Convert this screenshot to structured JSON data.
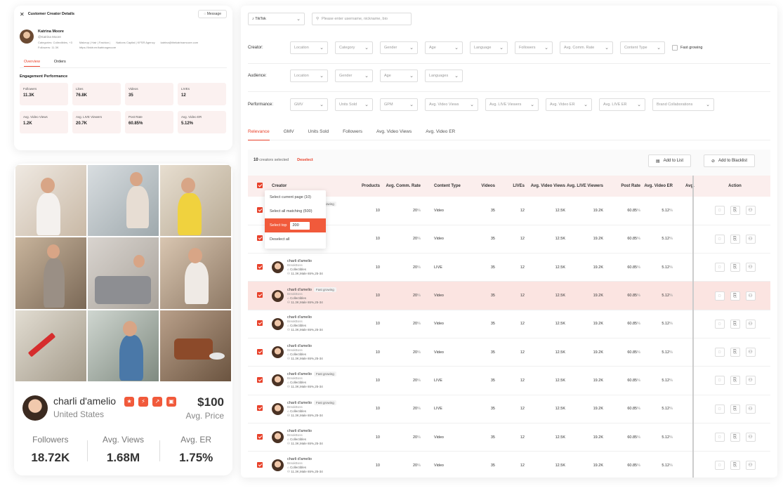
{
  "details": {
    "title": "Customer Creator Details",
    "message_label": "Message",
    "name": "Katrina Moore",
    "handle": "@Katrina Moore",
    "categories": "Categories: Collectibles, +3",
    "followers": "Followers: 11.3K",
    "tags": "Makeup | Hair | Fashion |",
    "agency": "Nations Capital | KFSR Agency",
    "email": "katrina@thekatrinamoore.com",
    "link": "https://linktr.ee/katrinagmoore",
    "tabs": [
      "Overview",
      "Orders"
    ],
    "engagement_title": "Engagement Performance",
    "stats": [
      {
        "label": "Followers",
        "value": "11.3K"
      },
      {
        "label": "Likes",
        "value": "76.8K"
      },
      {
        "label": "Videos",
        "value": "35"
      },
      {
        "label": "LIVEs",
        "value": "12"
      },
      {
        "label": "Avg. Video Views",
        "value": "1.2K"
      },
      {
        "label": "Avg. LIVE Viewers",
        "value": "20.7K"
      },
      {
        "label": "Post Rate",
        "value": "60.85%"
      },
      {
        "label": "Avg. Video ER",
        "value": "5.12%"
      }
    ]
  },
  "creator_card": {
    "name": "charli d'amelio",
    "country": "United States",
    "price": "$100",
    "price_label": "Avg. Price",
    "stats": [
      {
        "label": "Followers",
        "value": "18.72K"
      },
      {
        "label": "Avg. Views",
        "value": "1.68M"
      },
      {
        "label": "Avg. ER",
        "value": "1.75%"
      }
    ]
  },
  "filters": {
    "platform": "TikTok",
    "search_placeholder": "Please enter username, nickname, bio",
    "creator_label": "Creator:",
    "creator_filters": [
      "Location",
      "Category",
      "Gender",
      "Age",
      "Language",
      "Followers",
      "Avg. Comm. Rate",
      "Content Type"
    ],
    "fast_growing": "Fast growing",
    "audience_label": "Audience:",
    "audience_filters": [
      "Location",
      "Gender",
      "Age",
      "Languages"
    ],
    "performance_label": "Performance:",
    "performance_filters": [
      "GMV",
      "Units Sold",
      "GPM",
      "Avg. Video Views",
      "Avg. LIVE Viewers",
      "Avg. Video ER",
      "Avg. LIVE ER",
      "Brand Collaborations"
    ]
  },
  "sort_tabs": [
    "Relevance",
    "GMV",
    "Units Sold",
    "Followers",
    "Avg. Video Views",
    "Avg. Video ER"
  ],
  "toolbar": {
    "selected_count": "10",
    "selected_text": "creators selected",
    "deselect": "Deselect",
    "add_list": "Add to List",
    "add_blacklist": "Add to Blacklist"
  },
  "dropdown": {
    "current_page": "Select current page (10)",
    "all_matching": "Select all matching (500)",
    "select_top": "Select top",
    "top_value": "200",
    "deselect_all": "Deselect all"
  },
  "columns": [
    "Creator",
    "Products",
    "Avg. Comm. Rate",
    "Content Type",
    "Videos",
    "LIVEs",
    "Avg. Video Views",
    "Avg. LIVE Viewers",
    "Post Rate",
    "Avg. Video ER",
    "Avg.",
    "Action"
  ],
  "rows": [
    {
      "name": "charli d'amelio",
      "fast": "Fast growing",
      "brand": "BreakBoss",
      "cat": "Collectibles",
      "aud": "11.3K,Male 65%,25-34",
      "products": "10",
      "comm": "20",
      "ctype": "Video",
      "videos": "35",
      "lives": "12",
      "vviews": "12.5K",
      "lviewers": "19.2K",
      "prate": "60.85",
      "ver": "5.12",
      "hl": false
    },
    {
      "name": "charli d'amelio",
      "fast": "",
      "brand": "BreakBoss",
      "cat": "Collectibles",
      "aud": "11.3K,Male 65%,25-34",
      "products": "10",
      "comm": "20",
      "ctype": "Video",
      "videos": "35",
      "lives": "12",
      "vviews": "12.5K",
      "lviewers": "19.2K",
      "prate": "60.85",
      "ver": "5.12",
      "hl": false
    },
    {
      "name": "charli d'amelio",
      "fast": "",
      "brand": "BreakBoss",
      "cat": "Collectibles",
      "aud": "11.3K,Male 65%,25-34",
      "products": "10",
      "comm": "20",
      "ctype": "LIVE",
      "videos": "35",
      "lives": "12",
      "vviews": "12.5K",
      "lviewers": "19.2K",
      "prate": "60.85",
      "ver": "5.12",
      "hl": false
    },
    {
      "name": "charli d'amelio",
      "fast": "Fast growing",
      "brand": "BreakBoss",
      "cat": "Collectibles",
      "aud": "11.3K,Male 65%,25-34",
      "products": "10",
      "comm": "20",
      "ctype": "Video",
      "videos": "35",
      "lives": "12",
      "vviews": "12.5K",
      "lviewers": "19.2K",
      "prate": "60.85",
      "ver": "5.12",
      "hl": true
    },
    {
      "name": "charli d'amelio",
      "fast": "",
      "brand": "BreakBoss",
      "cat": "Collectibles",
      "aud": "11.3K,Male 65%,25-34",
      "products": "10",
      "comm": "20",
      "ctype": "Video",
      "videos": "35",
      "lives": "12",
      "vviews": "12.5K",
      "lviewers": "19.2K",
      "prate": "60.85",
      "ver": "5.12",
      "hl": false
    },
    {
      "name": "charli d'amelio",
      "fast": "",
      "brand": "BreakBoss",
      "cat": "Collectibles",
      "aud": "11.3K,Male 65%,25-34",
      "products": "10",
      "comm": "20",
      "ctype": "Video",
      "videos": "35",
      "lives": "12",
      "vviews": "12.5K",
      "lviewers": "19.2K",
      "prate": "60.85",
      "ver": "5.12",
      "hl": false
    },
    {
      "name": "charli d'amelio",
      "fast": "Fast growing",
      "brand": "BreakBoss",
      "cat": "Collectibles",
      "aud": "11.3K,Male 65%,25-34",
      "products": "10",
      "comm": "20",
      "ctype": "LIVE",
      "videos": "35",
      "lives": "12",
      "vviews": "12.5K",
      "lviewers": "19.2K",
      "prate": "60.85",
      "ver": "5.12",
      "hl": false
    },
    {
      "name": "charli d'amelio",
      "fast": "Fast growing",
      "brand": "BreakBoss",
      "cat": "Collectibles",
      "aud": "11.3K,Male 65%,25-34",
      "products": "10",
      "comm": "20",
      "ctype": "LIVE",
      "videos": "35",
      "lives": "12",
      "vviews": "12.5K",
      "lviewers": "19.2K",
      "prate": "60.85",
      "ver": "5.12",
      "hl": false
    },
    {
      "name": "charli d'amelio",
      "fast": "",
      "brand": "BreakBoss",
      "cat": "Collectibles",
      "aud": "11.3K,Male 65%,25-34",
      "products": "10",
      "comm": "20",
      "ctype": "Video",
      "videos": "35",
      "lives": "12",
      "vviews": "12.5K",
      "lviewers": "19.2K",
      "prate": "60.85",
      "ver": "5.12",
      "hl": false
    },
    {
      "name": "charli d'amelio",
      "fast": "",
      "brand": "BreakBoss",
      "cat": "Collectibles",
      "aud": "11.3K,Male 65%,25-34",
      "products": "10",
      "comm": "20",
      "ctype": "Video",
      "videos": "35",
      "lives": "12",
      "vviews": "12.5K",
      "lviewers": "19.2K",
      "prate": "60.85",
      "ver": "5.12",
      "hl": false
    }
  ],
  "colors": {
    "accent": "#e8412a",
    "highlight_row": "#fbe4e1",
    "stat_bg": "#fbf1f0"
  },
  "icons": [
    "close-icon",
    "message-icon",
    "tiktok-icon",
    "search-icon",
    "chevron-down-icon",
    "list-icon",
    "blacklist-icon",
    "chat-icon",
    "bookmark-icon",
    "user-block-icon",
    "shield-icon",
    "trend-icon",
    "bag-icon"
  ]
}
